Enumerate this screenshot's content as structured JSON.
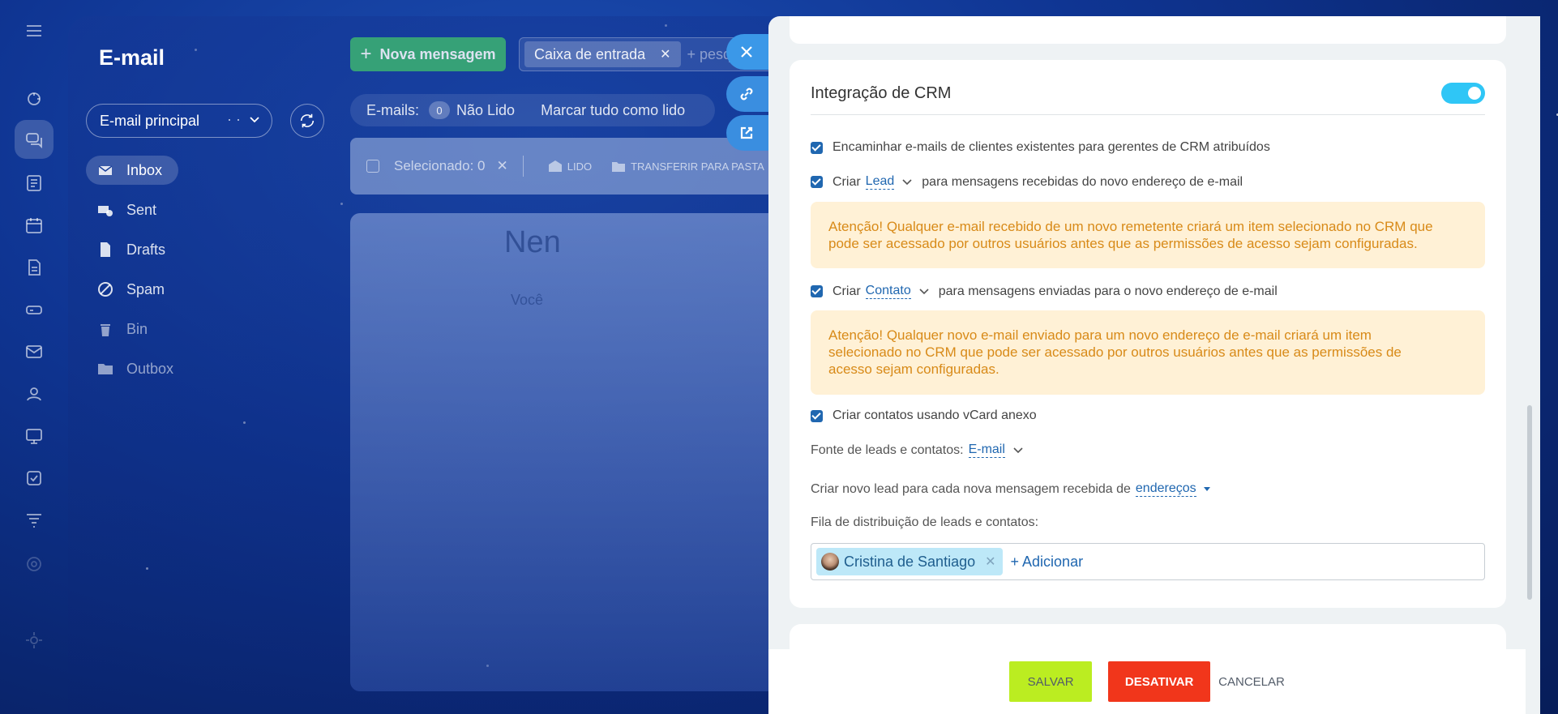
{
  "app": {
    "title": "E-mail",
    "mailbox": "E-mail principal",
    "folders": [
      {
        "label": "Inbox",
        "icon": "envelope-icon"
      },
      {
        "label": "Sent",
        "icon": "sent-icon"
      },
      {
        "label": "Drafts",
        "icon": "draft-icon"
      },
      {
        "label": "Spam",
        "icon": "spam-icon"
      },
      {
        "label": "Bin",
        "icon": "trash-icon"
      },
      {
        "label": "Outbox",
        "icon": "folder-icon"
      }
    ],
    "new_message": "Nova mensagem",
    "filter_tag": "Caixa de entrada",
    "filter_placeholder": "+ pesq",
    "counter": {
      "label": "E-mails:",
      "count": "0",
      "unread": "Não Lido",
      "mark_all": "Marcar tudo como lido"
    },
    "toolbar": {
      "selected": "Selecionado: 0",
      "read": "LIDO",
      "move": "TRANSFERIR PARA PASTA"
    },
    "empty": {
      "heading": "Nen",
      "sub": "Você"
    }
  },
  "crm": {
    "title": "Integração de CRM",
    "forward_option": "Encaminhar e-mails de clientes existentes para gerentes de CRM atribuídos",
    "create_label": "Criar",
    "incoming_entity": "Lead",
    "incoming_suffix": "para mensagens recebidas do novo endereço de e-mail",
    "warning_incoming": "Atenção! Qualquer e-mail recebido de um novo remetente criará um item selecionado no CRM que pode ser acessado por outros usuários antes que as permissões de acesso sejam configuradas.",
    "outgoing_entity": "Contato",
    "outgoing_suffix": "para mensagens enviadas para o novo endereço de e-mail",
    "warning_outgoing": "Atenção! Qualquer novo e-mail enviado para um novo endereço de e-mail criará um item selecionado no CRM que pode ser acessado por outros usuários antes que as permissões de acesso sejam configuradas.",
    "vcard_option": "Criar contatos usando vCard anexo",
    "source_label": "Fonte de leads e contatos:",
    "source_value": "E-mail",
    "new_lead_label": "Criar novo lead para cada nova mensagem recebida de",
    "new_lead_value": "endereços",
    "queue_label": "Fila de distribuição de leads e contatos:",
    "queue_user": "Cristina de Santiago",
    "queue_add": "+ Adicionar"
  },
  "footer": {
    "save": "SALVAR",
    "deactivate": "DESATIVAR",
    "cancel": "CANCELAR"
  },
  "colors": {
    "toggle_on": "#2fc6f6",
    "save": "#bbed21",
    "deactivate": "#f1361b",
    "warning_bg": "#fff1d6",
    "warning_text": "#d88a18",
    "link": "#2067b0"
  }
}
